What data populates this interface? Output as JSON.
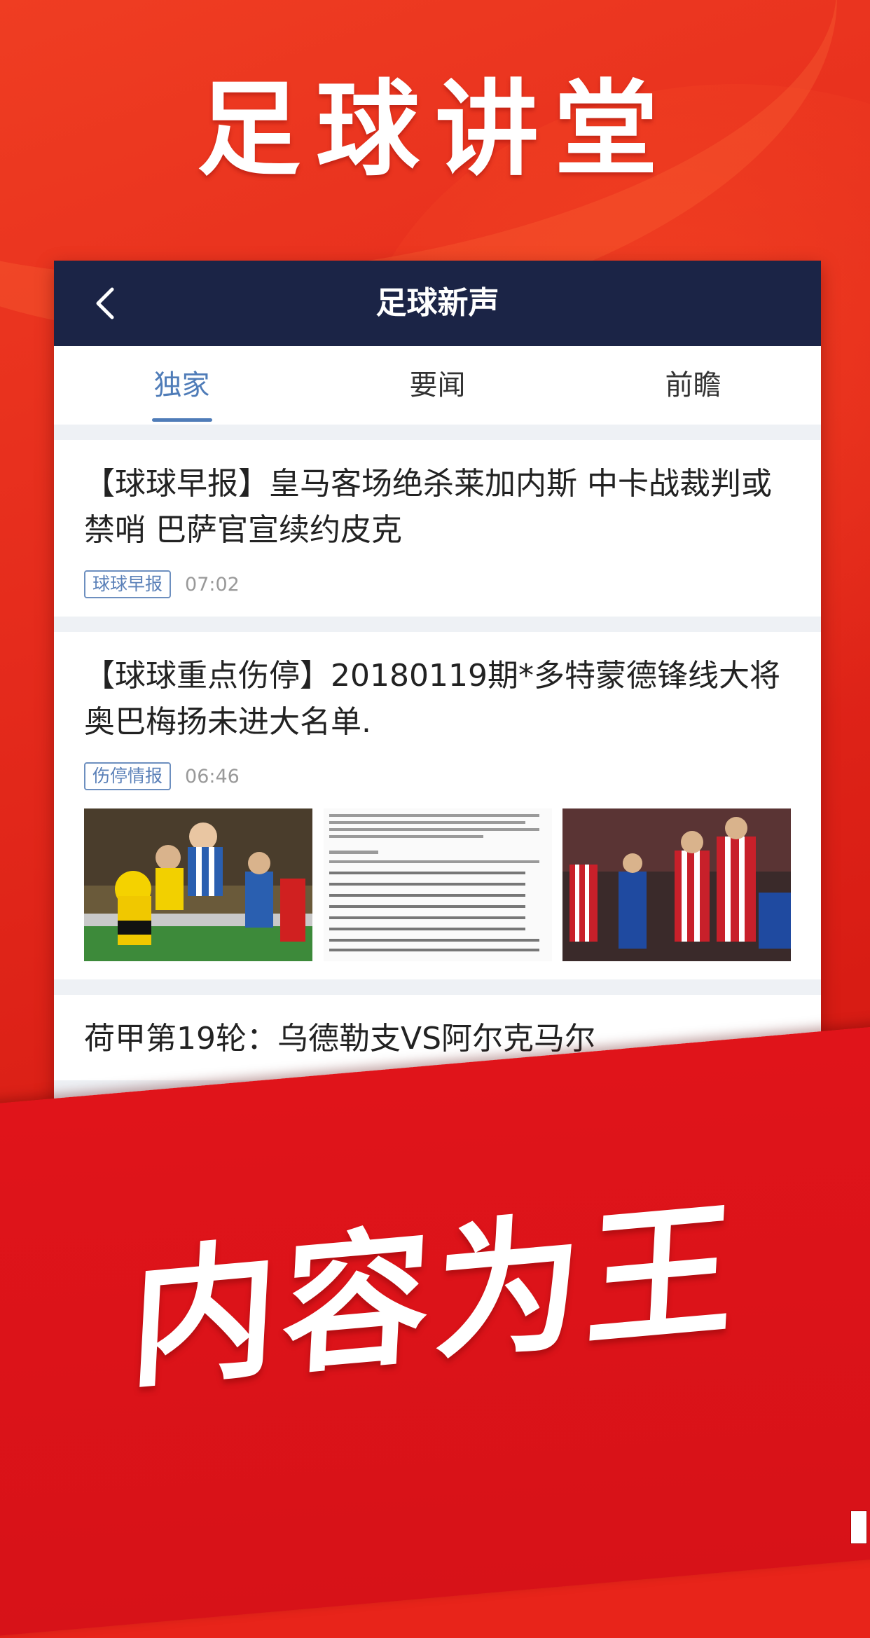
{
  "poster": {
    "top_title": "足球讲堂",
    "bottom_slogan": "内容为王"
  },
  "app": {
    "nav_title": "足球新声",
    "back_icon": "chevron-left-icon",
    "tabs": [
      {
        "label": "独家",
        "active": true
      },
      {
        "label": "要闻",
        "active": false
      },
      {
        "label": "前瞻",
        "active": false
      }
    ]
  },
  "feed": [
    {
      "title": "【球球早报】皇马客场绝杀莱加内斯 中卡战裁判或禁哨 巴萨官宣续约皮克",
      "tag": "球球早报",
      "time": "07:02"
    },
    {
      "title": "【球球重点伤停】20180119期*多特蒙德锋线大将奥巴梅扬未进大名单.",
      "tag": "伤停情报",
      "time": "06:46"
    },
    {
      "title": "荷甲第19轮：乌德勒支VS阿尔克马尔"
    }
  ],
  "colors": {
    "poster_red": "#e52b1c",
    "navbar": "#1b2446",
    "accent_blue": "#4f7cb8"
  }
}
